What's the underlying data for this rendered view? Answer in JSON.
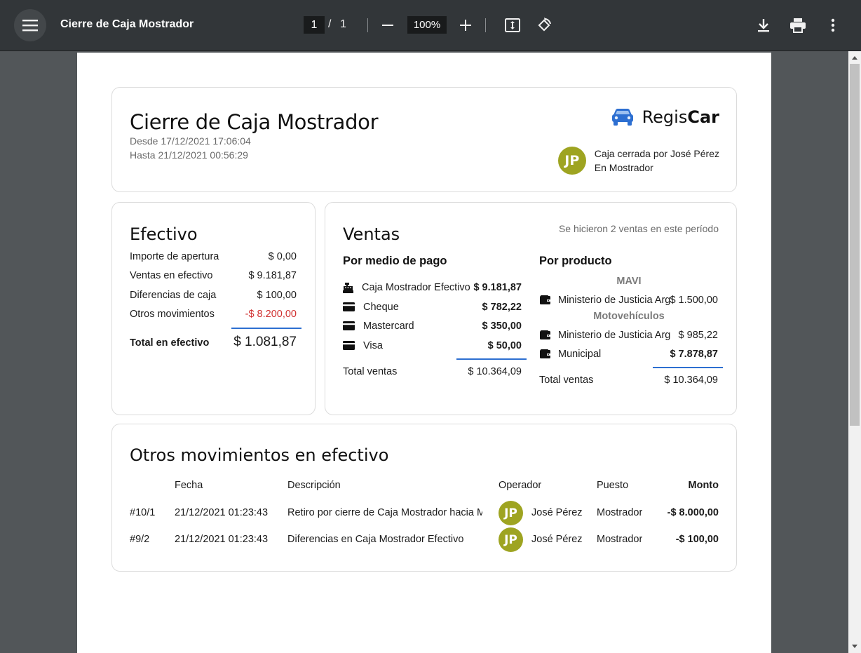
{
  "toolbar": {
    "title": "Cierre de Caja Mostrador",
    "page_current": "1",
    "page_sep": "/",
    "page_total": "1",
    "zoom": "100%"
  },
  "header": {
    "title": "Cierre de Caja Mostrador",
    "desde": "Desde 17/12/2021 17:06:04",
    "hasta": "Hasta 21/12/2021 00:56:29",
    "brand_light": "Regis",
    "brand_bold": "Car",
    "avatar_initials": "JP",
    "closed_by": "Caja cerrada por José Pérez",
    "closed_at": "En Mostrador",
    "brand_color": "#2d6fd1",
    "avatar_color": "#9ea421"
  },
  "efectivo": {
    "title": "Efectivo",
    "rows": [
      {
        "label": "Importe de apertura",
        "amount": "$ 0,00"
      },
      {
        "label": "Ventas en efectivo",
        "amount": "$ 9.181,87"
      },
      {
        "label": "Diferencias de caja",
        "amount": "$ 100,00"
      },
      {
        "label": "Otros movimientos",
        "amount": "-$ 8.200,00"
      }
    ],
    "total_label": "Total en efectivo",
    "total_amount": "$ 1.081,87"
  },
  "ventas": {
    "title": "Ventas",
    "note": "Se hicieron 2 ventas en este período",
    "por_medio": {
      "title": "Por medio de pago",
      "items": [
        {
          "icon": "cash-register-icon",
          "label": "Caja Mostrador Efectivo",
          "amount": "$ 9.181,87"
        },
        {
          "icon": "credit-card-icon",
          "label": "Cheque",
          "amount": "$ 782,22"
        },
        {
          "icon": "credit-card-icon",
          "label": "Mastercard",
          "amount": "$ 350,00"
        },
        {
          "icon": "credit-card-icon",
          "label": "Visa",
          "amount": "$ 50,00"
        }
      ],
      "total_label": "Total ventas",
      "total_amount": "$ 10.364,09"
    },
    "por_producto": {
      "title": "Por producto",
      "groups": [
        {
          "name": "MAVI",
          "items": [
            {
              "icon": "wallet-icon",
              "label": "Ministerio de Justicia Arg",
              "amount": "$ 1.500,00"
            }
          ]
        },
        {
          "name": "Motovehículos",
          "items": [
            {
              "icon": "wallet-icon",
              "label": "Ministerio de Justicia Arg",
              "amount": "$ 985,22"
            },
            {
              "icon": "wallet-icon",
              "label": "Municipal",
              "amount": "$ 7.878,87"
            }
          ]
        }
      ],
      "total_label": "Total ventas",
      "total_amount": "$ 10.364,09"
    }
  },
  "otros": {
    "title": "Otros movimientos en efectivo",
    "headers": {
      "fecha": "Fecha",
      "descripcion": "Descripción",
      "operador": "Operador",
      "puesto": "Puesto",
      "monto": "Monto"
    },
    "rows": [
      {
        "id": "#10/1",
        "fecha": "21/12/2021 01:23:43",
        "descripcion": "Retiro por cierre de Caja Mostrador hacia Mostrador",
        "avatar": "JP",
        "operador": "José Pérez",
        "puesto": "Mostrador",
        "monto": "-$ 8.000,00"
      },
      {
        "id": "#9/2",
        "fecha": "21/12/2021 01:23:43",
        "descripcion": "Diferencias en Caja Mostrador Efectivo",
        "avatar": "JP",
        "operador": "José Pérez",
        "puesto": "Mostrador",
        "monto": "-$ 100,00"
      }
    ]
  }
}
